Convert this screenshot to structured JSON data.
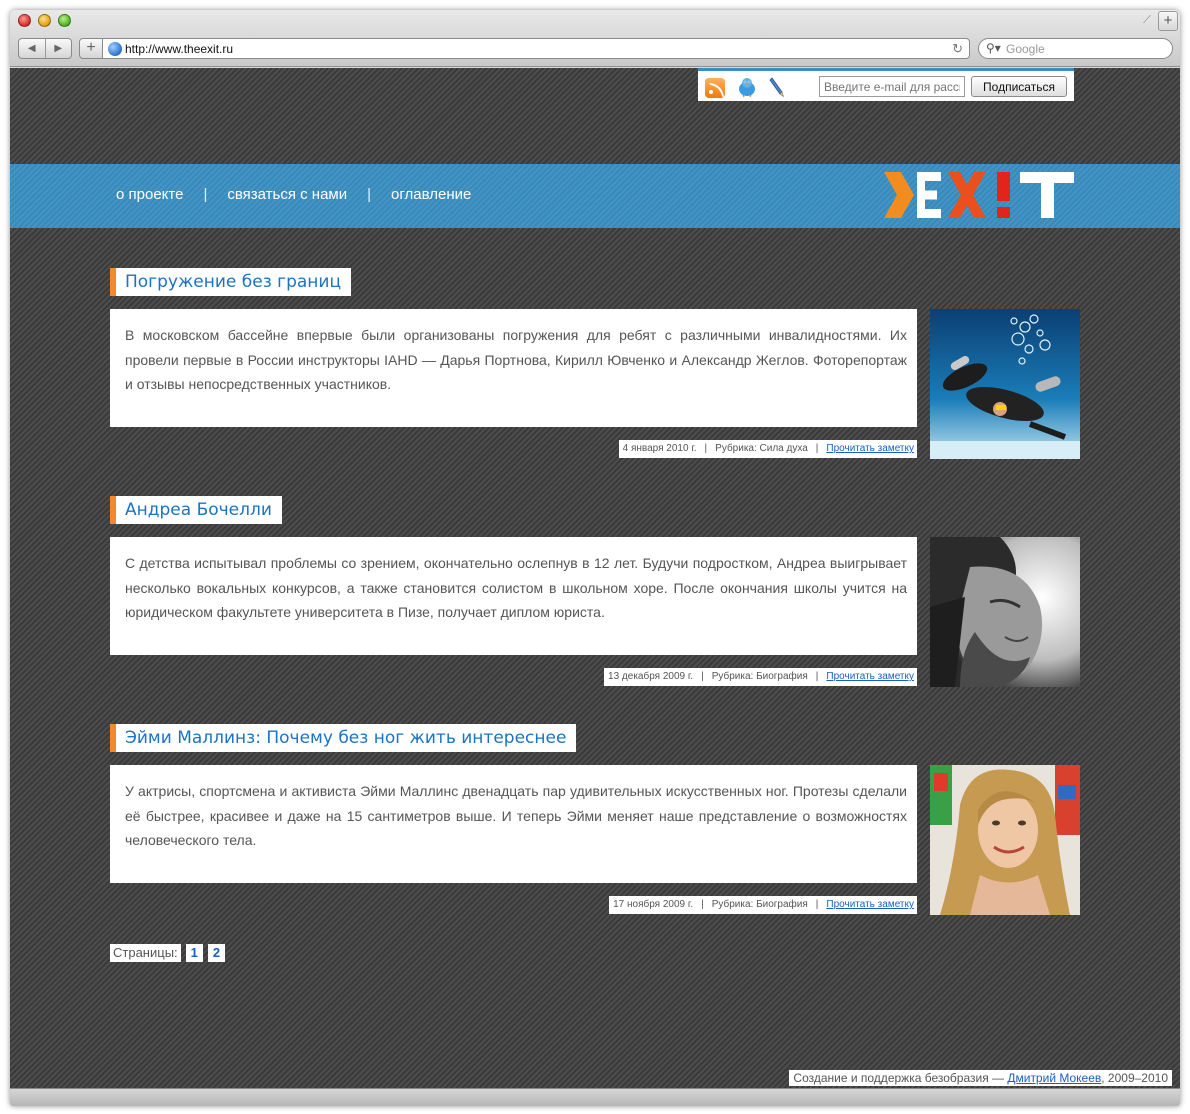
{
  "browser": {
    "url": "http://www.theexit.ru",
    "search_placeholder": "Google",
    "back_icon": "◀",
    "forward_icon": "▶",
    "add_icon": "+",
    "reload_icon": "↻",
    "search_icon": "🔍",
    "newtab_icon": "+"
  },
  "subscribe": {
    "email_placeholder": "Введите e-mail для рассылки",
    "button_label": "Подписаться"
  },
  "menu": {
    "items": [
      "о проекте",
      "связаться с нами",
      "оглавление"
    ],
    "separator": "|"
  },
  "logo": {
    "text": "EXIT"
  },
  "posts": [
    {
      "title": "Погружение без границ",
      "body": "В московском бассейне впервые были организованы погружения для ребят с различными инвалидностями. Их провели первые в России инструкторы IAHD — Дарья Портнова, Кирилл Ювченко и Александр Жеглов. Фоторепортаж и отзывы непосредственных участников.",
      "date": "4 января 2010 г.",
      "rubric": "Рубрика: Сила духа",
      "read_label": "Прочитать заметку"
    },
    {
      "title": "Андреа Бочелли",
      "body": "С детства испытывал проблемы со зрением, окончательно ослепнув в 12 лет. Будучи подростком, Андреа выигрывает несколько вокальных конкурсов, а также становится солистом в школьном хоре. После окончания школы учится на юридическом факультете университета в Пизе, получает диплом юриста.",
      "date": "13 декабря 2009 г.",
      "rubric": "Рубрика: Биография",
      "read_label": "Прочитать заметку"
    },
    {
      "title": "Эйми Маллинз: Почему без ног жить интереснее",
      "body": "У актрисы, спортсмена и активиста Эйми Маллинс двенадцать пар удивительных искусственных ног. Протезы сделали её быстрее, красивее и даже на 15 сантиметров выше. И теперь Эйми меняет наше представление о возможностях человеческого тела.",
      "date": "17 ноября 2009 г.",
      "rubric": "Рубрика: Биография",
      "read_label": "Прочитать заметку"
    }
  ],
  "meta_separator": "|",
  "pagination": {
    "label": "Страницы:",
    "pages": [
      "1",
      "2"
    ]
  },
  "footer": {
    "text_before": "Создание и поддержка безобразия — ",
    "author": "Дмитрий Мокеев",
    "text_after": ", 2009–2010"
  },
  "colors": {
    "accent_blue": "#3a8fc2",
    "title_blue": "#1a73c6",
    "title_marker_orange": "#f08a2c",
    "logo_orange": "#f28c1f",
    "logo_red": "#e3241b"
  }
}
